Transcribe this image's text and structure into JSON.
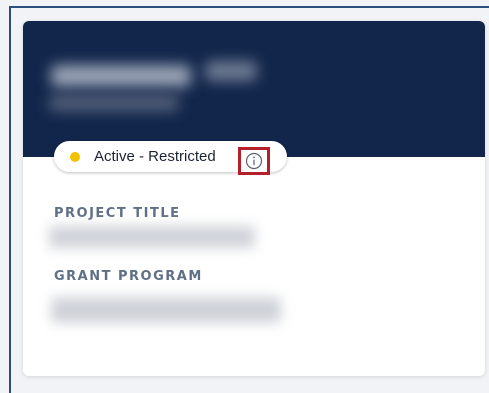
{
  "status": {
    "label": "Active - Restricted",
    "dot_color": "#f2c200",
    "info_icon": "info-circle-icon",
    "highlight_color": "#b51f2a"
  },
  "fields": {
    "project_title_label": "PROJECT TITLE",
    "grant_program_label": "GRANT PROGRAM"
  },
  "colors": {
    "header_background": "#12264b",
    "label_color": "#5f6f86"
  }
}
